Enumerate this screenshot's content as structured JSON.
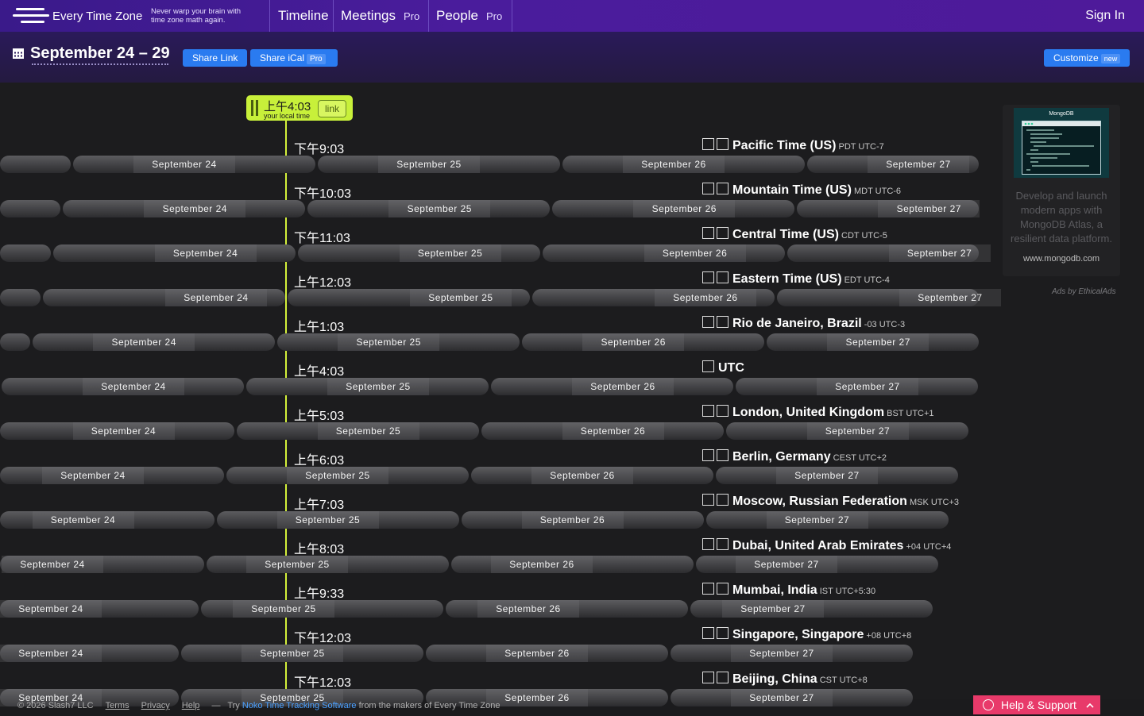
{
  "app": {
    "brand": "Every Time Zone",
    "tagline": "Never warp your brain with time zone math again."
  },
  "nav": [
    {
      "label": "Timeline",
      "badge": ""
    },
    {
      "label": "Meetings",
      "badge": "Pro"
    },
    {
      "label": "People",
      "badge": "Pro"
    }
  ],
  "signin": "Sign In",
  "header": {
    "date_range": "September 24 – 29",
    "share_link": "Share Link",
    "share_ical": "Share iCal",
    "share_ical_badge": "Pro",
    "customize": "Customize",
    "customize_badge": "new"
  },
  "localtime": {
    "time": "上午4:03",
    "sub": "your local time",
    "link": "link"
  },
  "days": [
    "September 24",
    "September 25",
    "September 26",
    "September 27"
  ],
  "zones": [
    {
      "time": "下午9:03",
      "name": "Pacific Time (US)",
      "abbr": "PDT UTC-7",
      "flags": 2
    },
    {
      "time": "下午10:03",
      "name": "Mountain Time (US)",
      "abbr": "MDT UTC-6",
      "flags": 2
    },
    {
      "time": "下午11:03",
      "name": "Central Time (US)",
      "abbr": "CDT UTC-5",
      "flags": 2
    },
    {
      "time": "上午12:03",
      "name": "Eastern Time (US)",
      "abbr": "EDT UTC-4",
      "flags": 2
    },
    {
      "time": "上午1:03",
      "name": "Rio de Janeiro, Brazil",
      "abbr": "-03 UTC-3",
      "flags": 2
    },
    {
      "time": "上午4:03",
      "name": "UTC",
      "abbr": "",
      "flags": 1
    },
    {
      "time": "上午5:03",
      "name": "London, United Kingdom",
      "abbr": "BST UTC+1",
      "flags": 2
    },
    {
      "time": "上午6:03",
      "name": "Berlin, Germany",
      "abbr": "CEST UTC+2",
      "flags": 2
    },
    {
      "time": "上午7:03",
      "name": "Moscow, Russian Federation",
      "abbr": "MSK UTC+3",
      "flags": 2
    },
    {
      "time": "上午8:03",
      "name": "Dubai, United Arab Emirates",
      "abbr": "+04 UTC+4",
      "flags": 2
    },
    {
      "time": "上午9:33",
      "name": "Mumbai, India",
      "abbr": "IST UTC+5:30",
      "flags": 2
    },
    {
      "time": "下午12:03",
      "name": "Singapore, Singapore",
      "abbr": "+08 UTC+8",
      "flags": 2
    },
    {
      "time": "下午12:03",
      "name": "Beijing, China",
      "abbr": "CST UTC+8",
      "flags": 2
    }
  ],
  "ad": {
    "brand": "MongoDB",
    "text": "Develop and launch modern apps with MongoDB Atlas, a resilient data platform.",
    "url": "www.mongodb.com",
    "by": "Ads by EthicalAds"
  },
  "footer": {
    "copyright": "© 2026 Slash7 LLC",
    "terms": "Terms",
    "privacy": "Privacy",
    "help": "Help",
    "dash": "—",
    "try": "Try",
    "noko": "Noko Time Tracking Software",
    "from": "from the makers of Every Time Zone"
  },
  "help_button": {
    "label": "Help & Support"
  }
}
